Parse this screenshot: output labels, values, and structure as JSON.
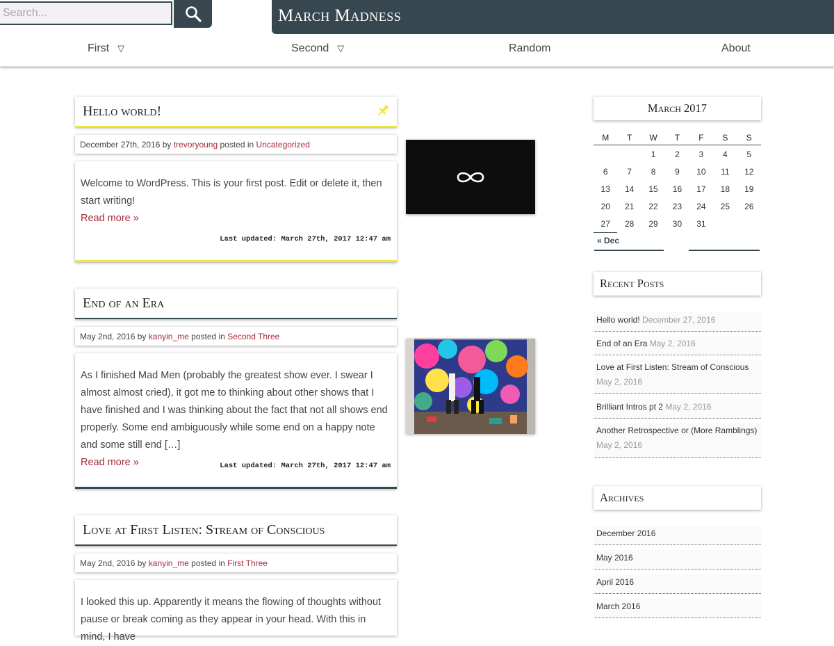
{
  "search": {
    "placeholder": "Search..."
  },
  "site": {
    "title": "March Madness"
  },
  "nav": [
    {
      "label": "First",
      "arrow": "▽"
    },
    {
      "label": "Second",
      "arrow": "▽"
    },
    {
      "label": "Random"
    },
    {
      "label": "About"
    }
  ],
  "posts": [
    {
      "title": "Hello world!",
      "pinned": true,
      "date": "December 27th, 2016",
      "by": "by",
      "author": "trevoryoung",
      "posted_in": "posted in",
      "category": "Uncategorized",
      "excerpt": "Welcome to WordPress. This is your first post. Edit or delete it, then start writing!",
      "read_more": "Read more »",
      "updated": "Last updated: March 27th, 2017 12:47 am",
      "accent": "#f2e63a"
    },
    {
      "title": "End of an Era",
      "date": "May 2nd, 2016",
      "by": "by",
      "author": "kanyin_me",
      "posted_in": "posted in",
      "category": "Second Three",
      "excerpt": "As I finished Mad Men (probably the greatest show ever. I swear I almost almost cried), it got me to thinking about other shows that I have finished and I was thinking about the fact that not all shows end properly. Some end ambiguously while some end on a happy note and some still end […]",
      "read_more": "Read more »",
      "updated": "Last updated: March 27th, 2017 12:47 am",
      "accent": "#37474f"
    },
    {
      "title": "Love at First Listen: Stream of Conscious",
      "date": "May 2nd, 2016",
      "by": "by",
      "author": "kanyin_me",
      "posted_in": "posted in",
      "category": "First Three",
      "excerpt": "I looked this up. Apparently it means the flowing of thoughts without pause or break coming as they appear in your head. With this in mind, I have"
    }
  ],
  "calendar": {
    "title": "March 2017",
    "weekdays": [
      "M",
      "T",
      "W",
      "T",
      "F",
      "S",
      "S"
    ],
    "weeks": [
      [
        "",
        "",
        "1",
        "2",
        "3",
        "4",
        "5"
      ],
      [
        "6",
        "7",
        "8",
        "9",
        "10",
        "11",
        "12"
      ],
      [
        "13",
        "14",
        "15",
        "16",
        "17",
        "18",
        "19"
      ],
      [
        "20",
        "21",
        "22",
        "23",
        "24",
        "25",
        "26"
      ],
      [
        "27",
        "28",
        "29",
        "30",
        "31",
        "",
        ""
      ]
    ],
    "prev": "« Dec"
  },
  "recent_posts": {
    "title": "Recent Posts",
    "items": [
      {
        "title": "Hello world!",
        "date": "December 27, 2016"
      },
      {
        "title": "End of an Era",
        "date": "May 2, 2016"
      },
      {
        "title": "Love at First Listen: Stream of Conscious",
        "date": "May 2, 2016"
      },
      {
        "title": "Brilliant Intros pt 2",
        "date": "May 2, 2016"
      },
      {
        "title": "Another Retrospective or (More Ramblings)",
        "date": "May 2, 2016"
      }
    ]
  },
  "archives": {
    "title": "Archives",
    "items": [
      "December 2016",
      "May 2016",
      "April 2016",
      "March 2016"
    ]
  },
  "colors": {
    "header": "#37474f",
    "link": "#a52a3a",
    "pin": "#f2e63a"
  },
  "icons": {
    "search": "search-icon",
    "pin": "pin-icon",
    "infinity": "infinity-icon"
  }
}
